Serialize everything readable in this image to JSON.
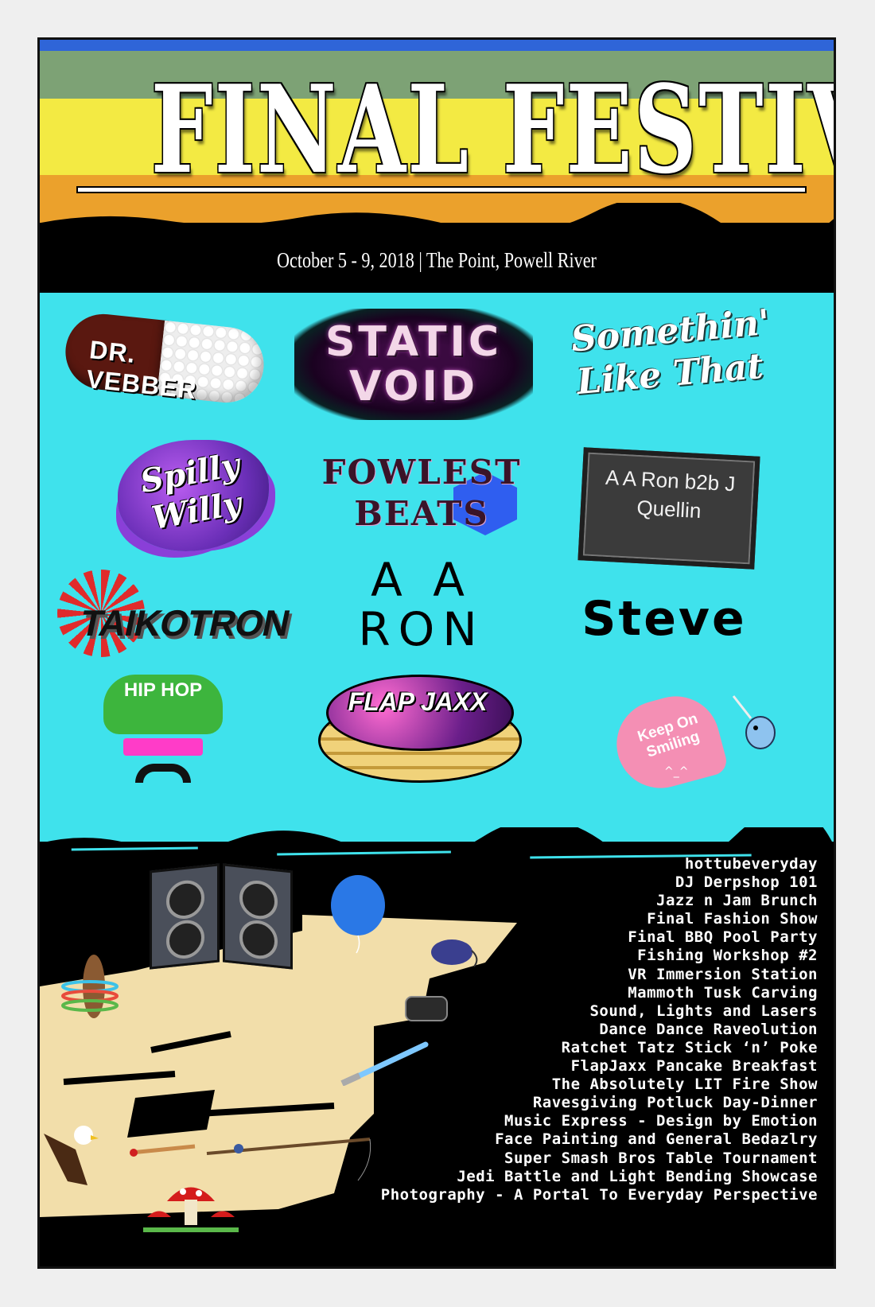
{
  "title": "FINAL FESTIVAL IV",
  "event_info": "October 5 - 9, 2018 | The Point, Powell River",
  "colors": {
    "stripe_blue": "#2f65d8",
    "stripe_green": "#7da275",
    "stripe_yellow": "#f3ea43",
    "stripe_orange": "#eba12c",
    "lineup_bg": "#3fe2ec",
    "sand": "#f2deaa"
  },
  "lineup": {
    "dr_vebber": "DR. VEBBER",
    "static_void": "STATIC VOID",
    "somethin_like_that": "Somethin' Like That",
    "spilly_willy": "Spilly Willy",
    "fowlest_beats": "FOWLEST BEATS",
    "aaron_b2b": "A A Ron b2b J Quellin",
    "taikotron": "TAIKOTRON",
    "a_a_ron": "A A RON",
    "steve": "Steve",
    "hip_hop": "HIP HOP",
    "flapjaxx": "FLAP JAXX",
    "keep_on_smiling": "Keep On Smiling",
    "smile_face": "^_^"
  },
  "icons": [
    "speaker-icon",
    "balloon-icon",
    "gamepad-icon",
    "vr-headset-icon",
    "lightsaber-icon",
    "hula-dog-icon",
    "eagle-icon",
    "paintbrush-icon",
    "fishing-rod-icon",
    "mushroom-icon",
    "narwhal-icon"
  ],
  "events": [
    "hottubeveryday",
    "DJ Derpshop 101",
    "Jazz n Jam Brunch",
    "Final Fashion Show",
    "Final BBQ Pool Party",
    "Fishing Workshop #2",
    "VR Immersion Station",
    "Mammoth Tusk Carving",
    "Sound, Lights and Lasers",
    "Dance Dance Raveolution",
    "Ratchet Tatz Stick ‘n’ Poke",
    "FlapJaxx Pancake Breakfast",
    "The Absolutely LIT Fire Show",
    "Ravesgiving Potluck Day-Dinner",
    "Music Express - Design by Emotion",
    "Face Painting and General Bedazlry",
    "Super Smash Bros Table Tournament",
    "Jedi Battle and Light Bending Showcase",
    "Photography - A Portal To Everyday Perspective"
  ]
}
